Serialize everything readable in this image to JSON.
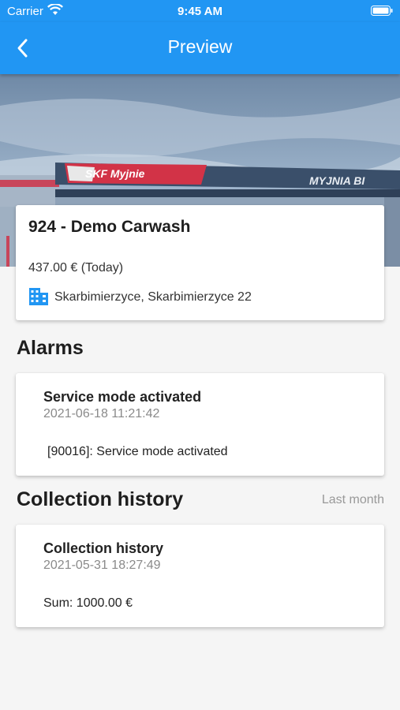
{
  "status_bar": {
    "carrier": "Carrier",
    "time": "9:45 AM"
  },
  "app_bar": {
    "title": "Preview",
    "back_icon": "chevron-left-icon"
  },
  "hero": {
    "sign_left": "SKF Myjnie",
    "sign_right": "MYJNIA BI"
  },
  "station": {
    "name": "924 - Demo Carwash",
    "revenue": "437.00 € (Today)",
    "address": "Skarbimierzyce, Skarbimierzyce 22",
    "location_icon": "building-icon"
  },
  "alarms": {
    "heading": "Alarms",
    "items": [
      {
        "title": "Service mode activated",
        "date": "2021-06-18 11:21:42",
        "message": "[90016]: Service mode activated"
      }
    ]
  },
  "collection_history": {
    "heading": "Collection history",
    "filter_label": "Last month",
    "items": [
      {
        "title": "Collection history",
        "date": "2021-05-31 18:27:49",
        "message": "Sum: 1000.00 €"
      }
    ]
  },
  "colors": {
    "primary": "#2196f3",
    "background": "#f5f5f5",
    "icon_blue": "#2196f3"
  }
}
